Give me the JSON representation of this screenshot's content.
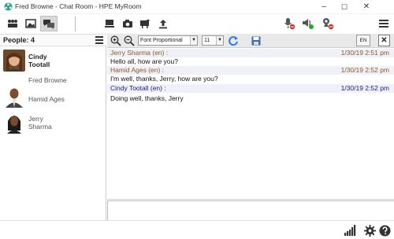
{
  "window": {
    "title": "Fred Browne - Chat Room - HPE MyRoom",
    "minimize": "–",
    "maximize": "☐",
    "close": "✕"
  },
  "people": {
    "header": "People: 4",
    "list": [
      {
        "name": "Cindy\nTootall",
        "bold": true
      },
      {
        "name": "Fred Browne",
        "bold": false
      },
      {
        "name": "Hamid Ages",
        "bold": false
      },
      {
        "name": "Jerry\nSharma",
        "bold": false
      }
    ]
  },
  "chat_toolbar": {
    "font": "Font Proportional",
    "size": "11",
    "language": "EN",
    "close": "✕"
  },
  "messages": [
    {
      "sender": "Jerry Sharma (en) :",
      "time": "1/30/19 2:51 pm",
      "text": "Hello all, how are you?",
      "color": "#8a5a2a"
    },
    {
      "sender": "Hamid Ages (en) :",
      "time": "1/30/19 2:52 pm",
      "text": "I'm well, thanks, Jerry, how are you?",
      "color": "#8a5a2a"
    },
    {
      "sender": "Cindy Tootall (en) :",
      "time": "1/30/19 2:52 pm",
      "text": "Doing well, thanks, Jerry",
      "color": "#1a1a8a"
    }
  ]
}
